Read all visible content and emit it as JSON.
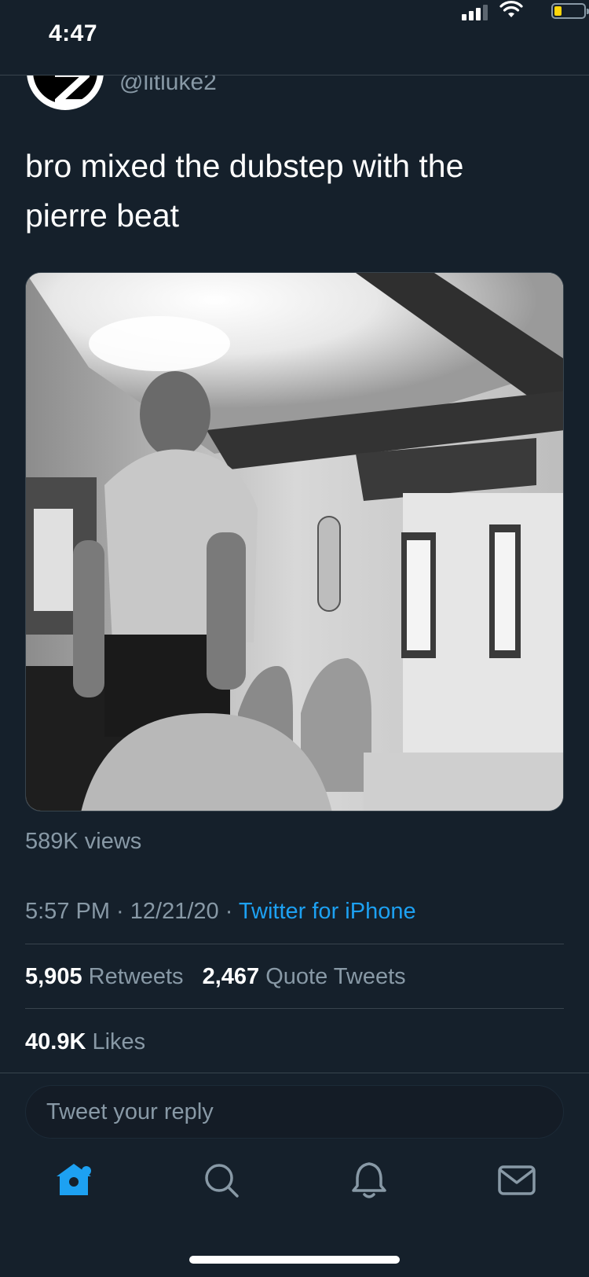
{
  "status_bar": {
    "time": "4:47",
    "battery_level": 0.15,
    "signal_bars": 3
  },
  "tweet": {
    "handle": "@litluke2",
    "text_line1": "bro mixed the dubstep with the",
    "text_line2": "pierre beat",
    "views": "589K views",
    "time": "5:57 PM",
    "sep1": " · ",
    "date": "12/21/20",
    "sep2": " · ",
    "source": "Twitter for iPhone"
  },
  "stats": {
    "retweets_count": "5,905",
    "retweets_label": "Retweets",
    "quotes_count": "2,467",
    "quotes_label": "Quote Tweets",
    "likes_count": "40.9K",
    "likes_label": "Likes"
  },
  "reply": {
    "placeholder": "Tweet your reply"
  },
  "tab_bar": {
    "items": [
      {
        "icon": "home-icon",
        "active": true
      },
      {
        "icon": "search-icon",
        "active": false
      },
      {
        "icon": "bell-icon",
        "active": false
      },
      {
        "icon": "mail-icon",
        "active": false
      }
    ]
  },
  "colors": {
    "background": "#15202b",
    "accent": "#1da1f2",
    "muted": "#8899a6",
    "divider": "#38444d"
  }
}
